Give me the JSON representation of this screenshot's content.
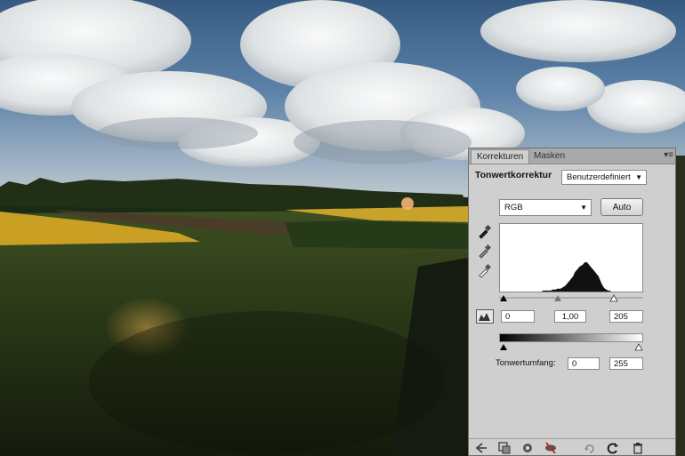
{
  "panel": {
    "tabs": [
      {
        "label": "Korrekturen",
        "active": true
      },
      {
        "label": "Masken",
        "active": false
      }
    ],
    "menu_glyph": "▾≡",
    "title": "Tonwertkorrektur",
    "preset": {
      "value": "Benutzerdefiniert"
    },
    "channel": {
      "value": "RGB"
    },
    "auto_label": "Auto",
    "input_levels": {
      "black": "0",
      "gamma": "1,00",
      "white": "205"
    },
    "output_label": "Tonwertumfang:",
    "output_levels": {
      "black": "0",
      "white": "255"
    },
    "histogram": [
      0,
      0,
      0,
      0,
      0,
      0,
      0,
      0,
      0,
      0,
      0,
      0,
      0,
      0,
      0,
      0,
      1,
      1,
      1,
      1,
      1,
      1,
      2,
      2,
      2,
      3,
      3,
      3,
      4,
      5,
      6,
      8,
      10,
      12,
      14,
      16,
      20,
      22,
      24,
      26,
      27,
      28,
      30,
      31,
      30,
      28,
      26,
      24,
      22,
      20,
      18,
      16,
      12,
      8,
      5,
      3,
      2,
      1,
      1,
      0,
      0,
      0,
      0,
      0,
      0,
      0,
      0,
      0,
      0,
      0,
      0,
      0,
      0,
      0
    ],
    "bottom_icons": [
      "back-arrow-icon",
      "clip-to-layer-icon",
      "visibility-eye-icon",
      "view-previous-icon",
      "reset-icon",
      "refresh-icon",
      "trash-icon"
    ]
  },
  "colors": {
    "panel_bg": "#cfcfcf",
    "tab_bar": "#a9a9a9",
    "sky_top": "#4a6d92",
    "grass": "#2d3a1a",
    "field_yellow": "#c9a22a"
  }
}
